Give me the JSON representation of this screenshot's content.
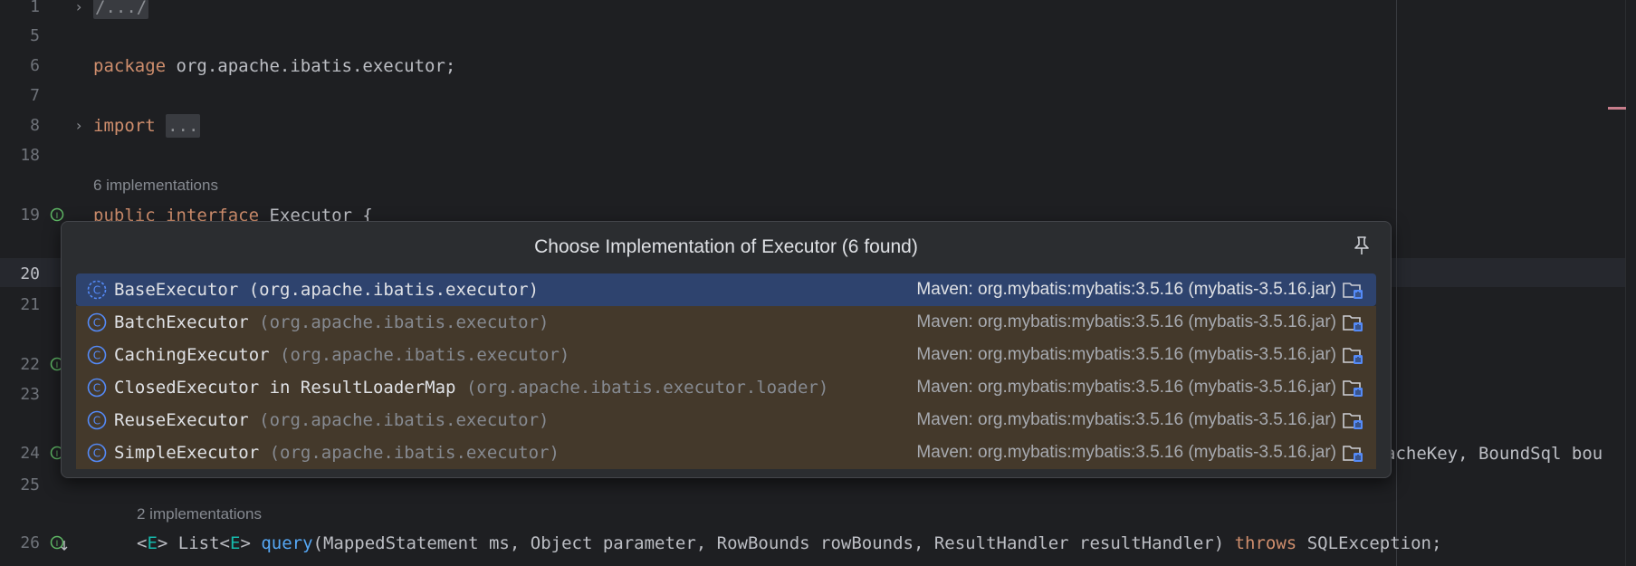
{
  "editor": {
    "lines": [
      {
        "num": "1",
        "folded": "/.../"
      },
      {
        "num": "5"
      },
      {
        "num": "6",
        "kw": "package",
        "rest": " org.apache.ibatis.executor;"
      },
      {
        "num": "7"
      },
      {
        "num": "8",
        "kw": "import",
        "folded": "..."
      },
      {
        "num": "18"
      },
      {
        "num": "19",
        "kw1": "public",
        "kw2": "interface",
        "rest": " Executor {"
      },
      {
        "num": "20"
      },
      {
        "num": "21"
      },
      {
        "num": "22"
      },
      {
        "num": "23"
      },
      {
        "num": "24",
        "tail": "acheKey, BoundSql bou"
      },
      {
        "num": "25"
      },
      {
        "num": "26",
        "lt": "<",
        "e1": "E",
        "gt": "> List<",
        "e2": "E",
        "gt2": "> ",
        "method": "query",
        "args": "(MappedStatement ms, Object parameter, RowBounds rowBounds, ResultHandler resultHandler) ",
        "throws": "throws",
        "exc": " SQLException;"
      }
    ],
    "hint_top": "6 implementations",
    "hint_bottom": "2 implementations"
  },
  "popup": {
    "title": "Choose Implementation of Executor (6 found)",
    "pin_icon": "pin-icon",
    "items": [
      {
        "name": "BaseExecutor",
        "pkg": " (org.apache.ibatis.executor)",
        "lib": "Maven: org.mybatis:mybatis:3.5.16 (mybatis-3.5.16.jar)",
        "selected": true
      },
      {
        "name": "BatchExecutor",
        "pkg": " (org.apache.ibatis.executor)",
        "lib": "Maven: org.mybatis:mybatis:3.5.16 (mybatis-3.5.16.jar)"
      },
      {
        "name": "CachingExecutor",
        "pkg": " (org.apache.ibatis.executor)",
        "lib": "Maven: org.mybatis:mybatis:3.5.16 (mybatis-3.5.16.jar)"
      },
      {
        "name": "ClosedExecutor in ResultLoaderMap",
        "pkg": " (org.apache.ibatis.executor.loader)",
        "lib": "Maven: org.mybatis:mybatis:3.5.16 (mybatis-3.5.16.jar)"
      },
      {
        "name": "ReuseExecutor",
        "pkg": " (org.apache.ibatis.executor)",
        "lib": "Maven: org.mybatis:mybatis:3.5.16 (mybatis-3.5.16.jar)"
      },
      {
        "name": "SimpleExecutor",
        "pkg": " (org.apache.ibatis.executor)",
        "lib": "Maven: org.mybatis:mybatis:3.5.16 (mybatis-3.5.16.jar)"
      }
    ]
  },
  "colors": {
    "background": "#1e1f22",
    "popup_bg": "#2b2d30",
    "selected_row": "#2e436e",
    "row_highlight": "#44392b",
    "keyword": "#cf8e6d",
    "method": "#56a8f5"
  }
}
